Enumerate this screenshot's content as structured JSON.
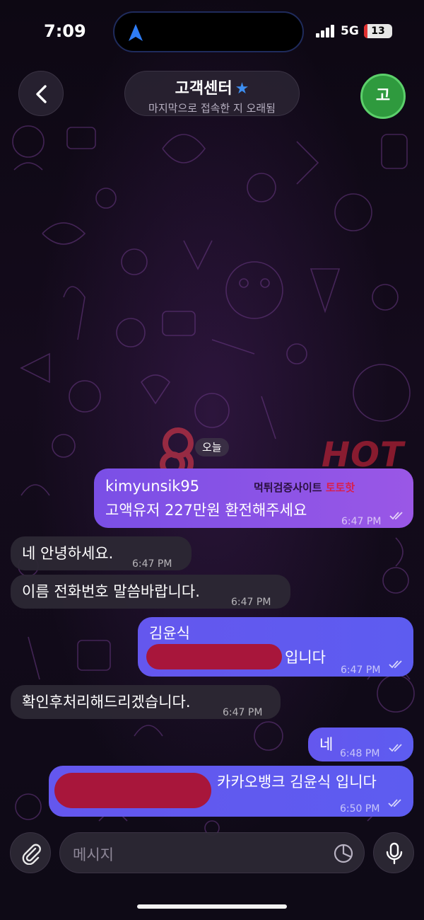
{
  "status_bar": {
    "time": "7:09",
    "network": "5G",
    "battery": "13",
    "battery_level": 0.13
  },
  "header": {
    "title": "고객센터",
    "subtitle": "마지막으로 접속한 지 오래됨",
    "avatar_initial": "고",
    "colors": {
      "verified_star": "#3d8ef0",
      "avatar_bg": "#2f9a3e"
    }
  },
  "chat": {
    "date_label": "오늘",
    "watermark": {
      "text": "HOT",
      "caption_prefix": "먹튀검증사이트 ",
      "caption_brand": "토토핫"
    },
    "messages": [
      {
        "direction": "outgoing",
        "line1": "kimyunsik95",
        "line2": "고액유저 227만원 환전해주세요",
        "time": "6:47 PM",
        "status": "read"
      },
      {
        "direction": "incoming",
        "text": "네 안녕하세요.",
        "time": "6:47 PM"
      },
      {
        "direction": "incoming",
        "text": "이름 전화번호 말씀바랍니다.",
        "time": "6:47 PM"
      },
      {
        "direction": "outgoing",
        "line1": "김윤식",
        "line2": "입니다",
        "time": "6:47 PM",
        "status": "read"
      },
      {
        "direction": "incoming",
        "text": "확인후처리해드리겠습니다.",
        "time": "6:47 PM"
      },
      {
        "direction": "outgoing",
        "text": "네",
        "time": "6:48 PM",
        "status": "read"
      },
      {
        "direction": "outgoing",
        "text": "카카오뱅크 김윤식 입니다",
        "time": "6:50 PM",
        "status": "read"
      }
    ]
  },
  "composer": {
    "placeholder": "메시지"
  },
  "icons": [
    "back-chevron-icon",
    "navigation-arrow-icon",
    "signal-icon",
    "star-icon",
    "paperclip-icon",
    "sticker-icon",
    "microphone-icon",
    "double-check-icon"
  ]
}
